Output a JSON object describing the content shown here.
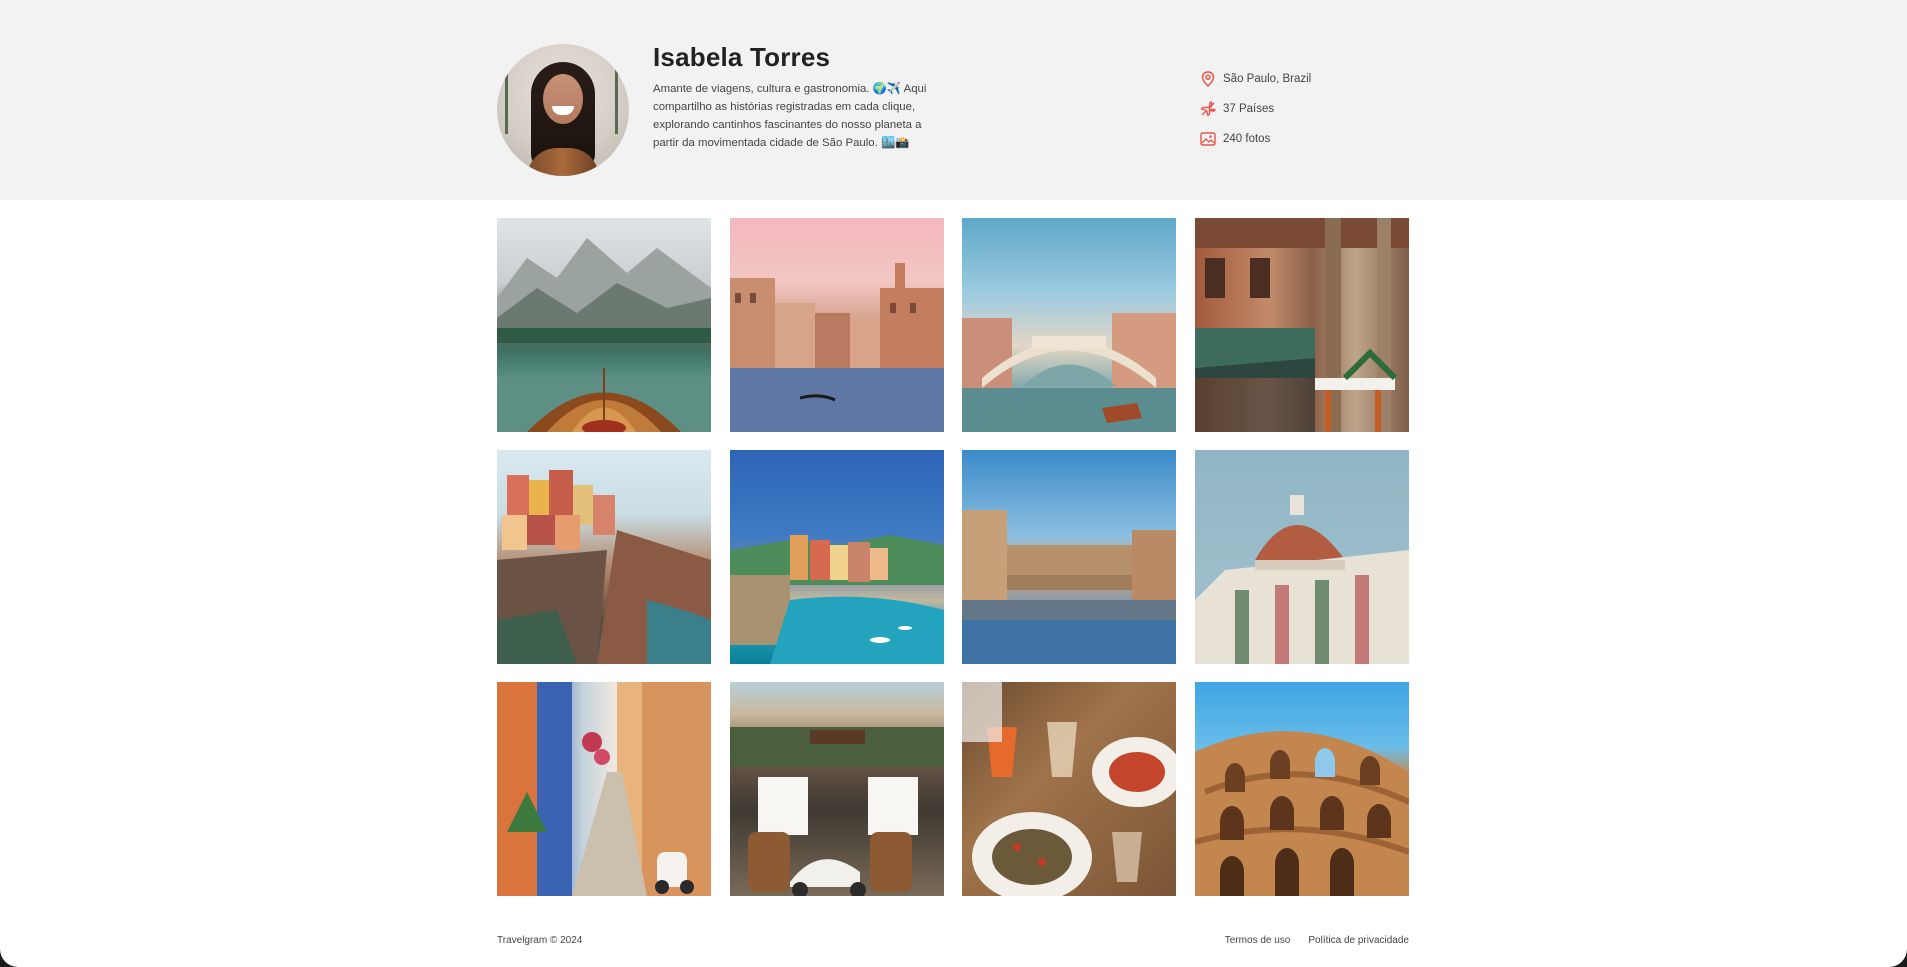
{
  "profile": {
    "name": "Isabela Torres",
    "bio": "Amante de viagens, cultura e gastronomia. 🌍✈️ Aqui compartilho as histórias registradas em cada clique, explorando cantinhos fascinantes do nosso planeta a partir da movimentada cidade de São Paulo. 🏙️📸"
  },
  "stats": {
    "location": "São Paulo, Brazil",
    "countries": "37 Países",
    "photos": "240 fotos"
  },
  "icons": {
    "location": "map-pin-icon",
    "countries": "plane-icon",
    "photos": "image-icon"
  },
  "colors": {
    "accent": "#e2574c",
    "header_bg": "#f2f2f2"
  },
  "gallery": {
    "photos": [
      "mountain-lake-boat",
      "venice-canal-sunset",
      "rialto-bridge",
      "venice-restaurant-terrace",
      "manarola-cliff-village",
      "vernazza-harbor",
      "ponte-vecchio",
      "florence-duomo",
      "colorful-alley-vespa",
      "cafe-vespa-barrels",
      "pasta-and-wine-table",
      "colosseum"
    ]
  },
  "footer": {
    "copyright": "Travelgram © 2024",
    "terms": "Termos de uso",
    "privacy": "Política de privacidade"
  }
}
